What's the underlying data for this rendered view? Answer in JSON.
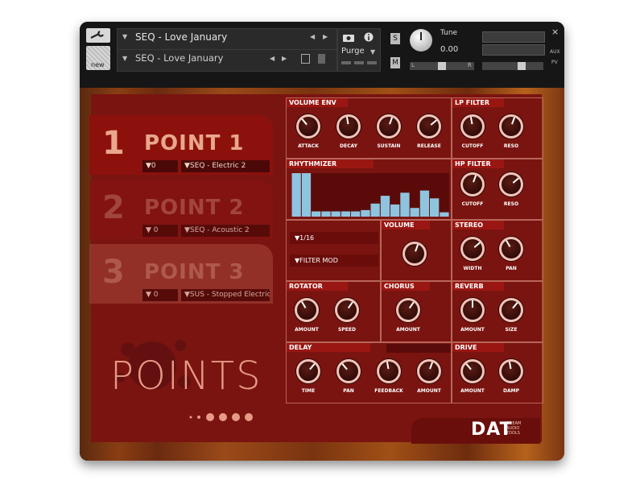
{
  "header": {
    "wrench_label": "",
    "new_label": "new",
    "instrument_name": "SEQ - Love January",
    "snapshot_name": "SEQ - Love January",
    "purge_label": "Purge",
    "s_label": "S",
    "m_label": "M",
    "tune_label": "Tune",
    "tune_value": "0.00",
    "pan_left": "L",
    "pan_right": "R",
    "aux_label": "AUX",
    "pv_label": "PV",
    "close_glyph": "×"
  },
  "slots": [
    {
      "number": "1",
      "title": "POINT 1",
      "transpose": "0",
      "source": "SEQ - Electric 2"
    },
    {
      "number": "2",
      "title": "POINT 2",
      "transpose": "0",
      "source": "SEQ - Acoustic 2"
    },
    {
      "number": "3",
      "title": "POINT 3",
      "transpose": "0",
      "source": "SUS - Stopped Electric"
    }
  ],
  "logo": {
    "text": "POINTS"
  },
  "brand": {
    "text": "DAT",
    "sub": [
      "DREAM",
      "AUDIO",
      "TOOLS"
    ]
  },
  "volume_env": {
    "title": "VOLUME ENV",
    "knobs": [
      "ATTACK",
      "DECAY",
      "SUSTAIN",
      "RELEASE"
    ]
  },
  "lp_filter": {
    "title": "LP FILTER",
    "knobs": [
      "CUTOFF",
      "RESO"
    ]
  },
  "hp_filter": {
    "title": "HP FILTER",
    "knobs": [
      "CUTOFF",
      "RESO"
    ]
  },
  "rhythmizer": {
    "title": "RHYTHMIZER",
    "steps": [
      1.0,
      1.0,
      0.12,
      0.12,
      0.12,
      0.12,
      0.12,
      0.15,
      0.3,
      0.48,
      0.28,
      0.55,
      0.2,
      0.6,
      0.42,
      0.1
    ],
    "rate": "1/16",
    "mode": "FILTER MOD"
  },
  "volume": {
    "title": "VOLUME"
  },
  "stereo": {
    "title": "STEREO",
    "knobs": [
      "WIDTH",
      "PAN"
    ]
  },
  "rotator": {
    "title": "ROTATOR",
    "knobs": [
      "AMOUNT",
      "SPEED"
    ]
  },
  "chorus": {
    "title": "CHORUS",
    "knobs": [
      "AMOUNT"
    ]
  },
  "reverb": {
    "title": "REVERB",
    "knobs": [
      "AMOUNT",
      "SIZE"
    ]
  },
  "delay": {
    "title": "DELAY",
    "knobs": [
      "TIME",
      "PAN",
      "FEEDBACK",
      "AMOUNT"
    ]
  },
  "drive": {
    "title": "DRIVE",
    "knobs": [
      "AMOUNT",
      "DAMP"
    ]
  },
  "colors": {
    "panel_red": "#7a1410",
    "accent_knob": "#f2c3b8",
    "bar_blue": "#8fc4df"
  }
}
